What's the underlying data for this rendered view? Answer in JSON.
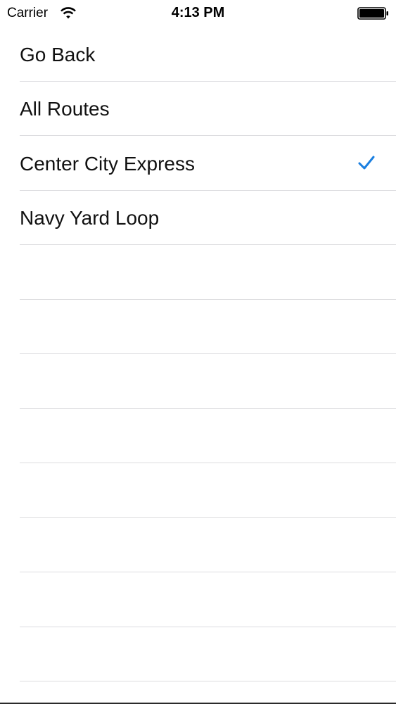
{
  "status_bar": {
    "carrier": "Carrier",
    "time": "4:13 PM",
    "wifi_icon": "wifi-icon",
    "battery_icon": "battery-icon"
  },
  "routes_list": {
    "items": [
      {
        "label": "Go Back",
        "selected": false
      },
      {
        "label": "All Routes",
        "selected": false
      },
      {
        "label": "Center City Express",
        "selected": true
      },
      {
        "label": "Navy Yard Loop",
        "selected": false
      }
    ],
    "empty_rows": 8
  },
  "colors": {
    "accent": "#1a7fe0",
    "separator": "#dcdcdf",
    "text": "#111111"
  },
  "icons": {
    "selected_indicator": "checkmark-icon"
  }
}
